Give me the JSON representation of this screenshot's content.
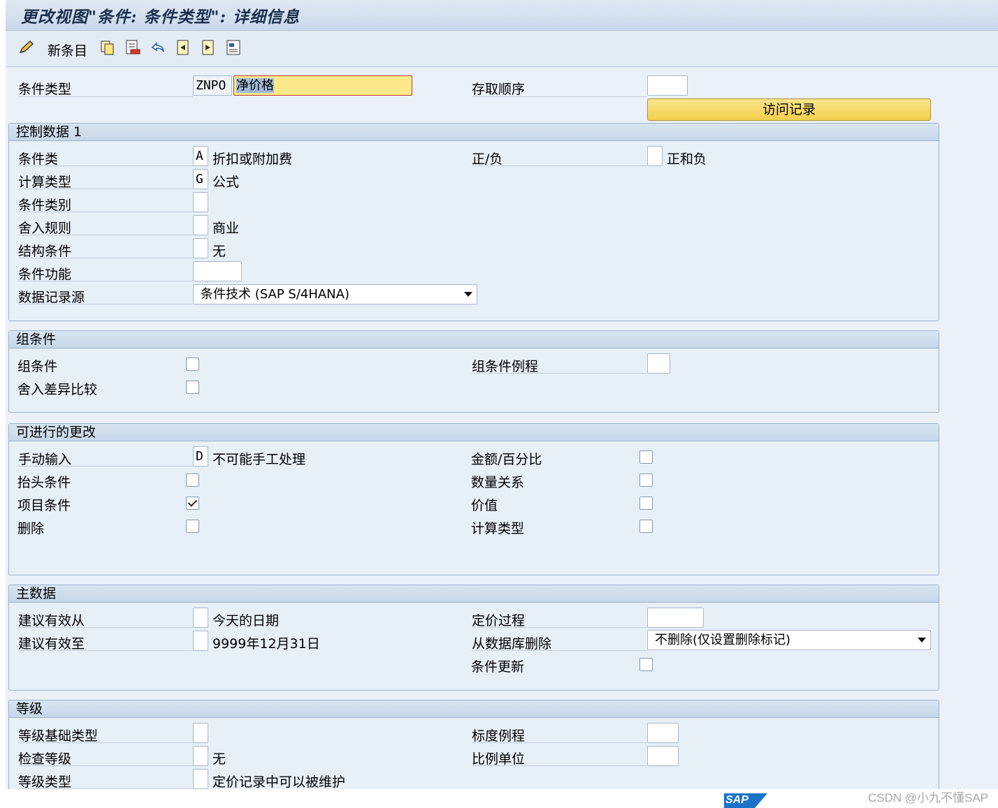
{
  "title": "更改视图\"条件: 条件类型\": 详细信息",
  "toolbar": {
    "new_entry": "新条目",
    "icons": [
      "edit-icon",
      "copy-icon",
      "delete-icon",
      "undo-icon",
      "previous-icon",
      "next-icon",
      "other-entry-icon"
    ]
  },
  "header": {
    "cond_type_label": "条件类型",
    "cond_type_code": "ZNPO",
    "cond_type_name": "净价格",
    "access_seq_label": "存取顺序",
    "access_seq_value": "",
    "access_btn": "访问记录"
  },
  "control": {
    "title": "控制数据 1",
    "cond_class_label": "条件类",
    "cond_class_value": "A",
    "cond_class_text": "折扣或附加费",
    "plus_minus_label": "正/负",
    "plus_minus_value": "",
    "plus_minus_text": "正和负",
    "calc_type_label": "计算类型",
    "calc_type_value": "G",
    "calc_type_text": "公式",
    "cond_cat_label": "条件类别",
    "cond_cat_value": "",
    "rounding_label": "舍入规则",
    "rounding_value": "",
    "rounding_text": "商业",
    "struct_label": "结构条件",
    "struct_value": "",
    "struct_text": "无",
    "func_label": "条件功能",
    "func_value": "",
    "source_label": "数据记录源",
    "source_value": "条件技术 (SAP S/4HANA)"
  },
  "group_cond": {
    "title": "组条件",
    "group_label": "组条件",
    "group_checked": false,
    "round_diff_label": "舍入差异比较",
    "round_diff_checked": false,
    "routine_label": "组条件例程",
    "routine_value": ""
  },
  "changes": {
    "title": "可进行的更改",
    "manual_label": "手动输入",
    "manual_value": "D",
    "manual_text": "不可能手工处理",
    "header_label": "抬头条件",
    "header_checked": false,
    "item_label": "项目条件",
    "item_checked": true,
    "delete_label": "删除",
    "delete_checked": false,
    "amount_label": "金额/百分比",
    "amount_checked": false,
    "qty_label": "数量关系",
    "qty_checked": false,
    "value_label": "价值",
    "value_checked": false,
    "calc_label": "计算类型",
    "calc_checked": false
  },
  "master": {
    "title": "主数据",
    "valid_from_label": "建议有效从",
    "valid_from_value": "",
    "valid_from_text": "今天的日期",
    "valid_to_label": "建议有效至",
    "valid_to_value": "",
    "valid_to_text": "9999年12月31日",
    "pricing_label": "定价过程",
    "pricing_value": "",
    "db_delete_label": "从数据库删除",
    "db_delete_value": "不删除(仅设置删除标记)",
    "cond_update_label": "条件更新",
    "cond_update_checked": false
  },
  "scales": {
    "title": "等级",
    "base_label": "等级基础类型",
    "base_value": "",
    "check_label": "检查等级",
    "check_value": "",
    "check_text": "无",
    "type_label": "等级类型",
    "type_value": "",
    "type_text": "定价记录中可以被维护",
    "routine_label": "标度例程",
    "routine_value": "",
    "unit_label": "比例单位",
    "unit_value": ""
  },
  "footer": {
    "logo": "SAP",
    "watermark": "CSDN @小九不懂SAP"
  }
}
